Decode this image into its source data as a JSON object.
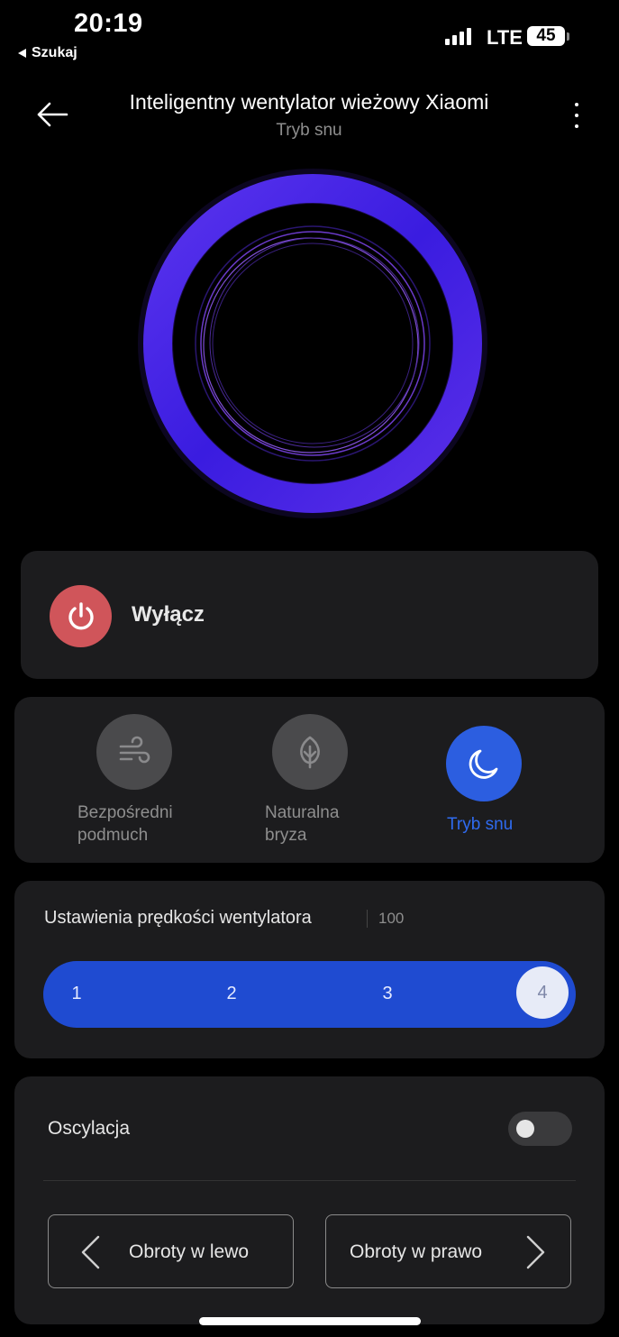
{
  "status_bar": {
    "time": "20:19",
    "back_app": "Szukaj",
    "network": "LTE",
    "battery": "45"
  },
  "header": {
    "title": "Inteligentny wentylator wieżowy Xiaomi",
    "subtitle": "Tryb snu"
  },
  "power": {
    "label": "Wyłącz",
    "color": "#d0555a"
  },
  "modes": [
    {
      "line1": "Bezpośredni",
      "line2": "podmuch",
      "active": false
    },
    {
      "line1": "Naturalna",
      "line2": "bryza",
      "active": false
    },
    {
      "line1": "Tryb snu",
      "line2": "",
      "active": true
    }
  ],
  "speed": {
    "title": "Ustawienia prędkości wentylatora",
    "value": "100",
    "levels": [
      "1",
      "2",
      "3",
      "4"
    ],
    "selected": "4",
    "track_color": "#1f4bd1"
  },
  "oscillation": {
    "label": "Oscylacja",
    "enabled": false,
    "rotate_left": "Obroty w lewo",
    "rotate_right": "Obroty w prawo"
  },
  "colors": {
    "ring": "#4a22e6",
    "accent": "#2c5ee0"
  }
}
